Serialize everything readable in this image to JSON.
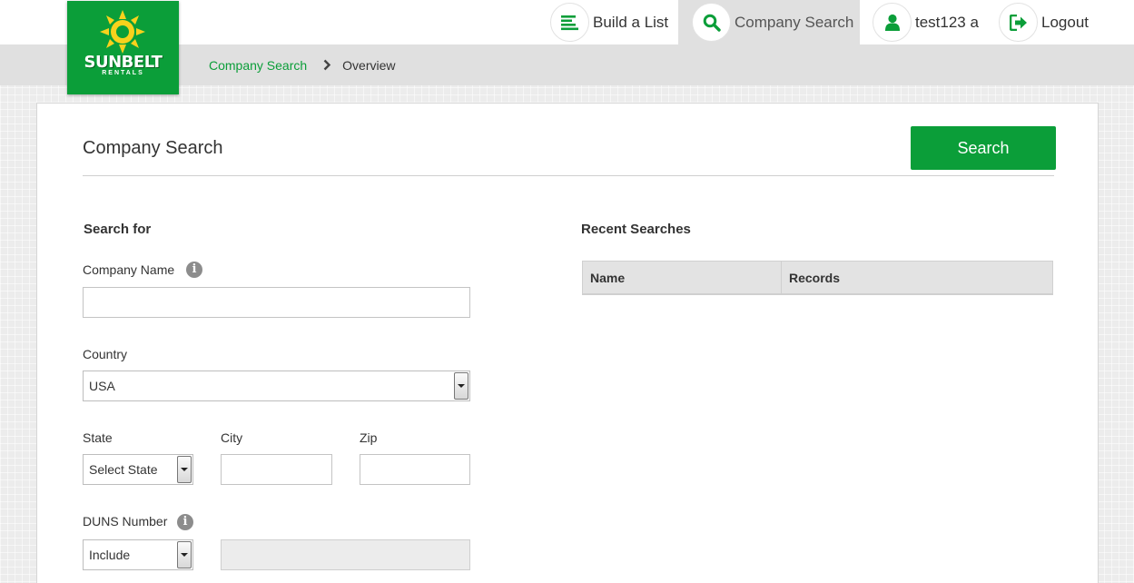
{
  "brand": {
    "name": "SUNBELT",
    "sub": "RENTALS",
    "accent": "#0b9e39"
  },
  "nav": {
    "build_list": "Build a List",
    "company_search": "Company Search",
    "user": "test123 a",
    "logout": "Logout"
  },
  "breadcrumb": {
    "link": "Company Search",
    "current": "Overview"
  },
  "page": {
    "title": "Company Search",
    "search_button": "Search"
  },
  "form": {
    "section": "Search for",
    "company_name_label": "Company Name",
    "company_name_value": "",
    "country_label": "Country",
    "country_value": "USA",
    "state_label": "State",
    "state_value": "Select State",
    "city_label": "City",
    "city_value": "",
    "zip_label": "Zip",
    "zip_value": "",
    "duns_label": "DUNS Number",
    "duns_mode": "Include",
    "duns_value": ""
  },
  "recent": {
    "title": "Recent Searches",
    "columns": [
      "Name",
      "Records"
    ]
  },
  "icons": {
    "build_list": "list-icon",
    "company_search": "search-icon",
    "user": "user-icon",
    "logout": "logout-icon",
    "info": "info-icon",
    "breadcrumb_sep": "chevron-right-icon"
  }
}
